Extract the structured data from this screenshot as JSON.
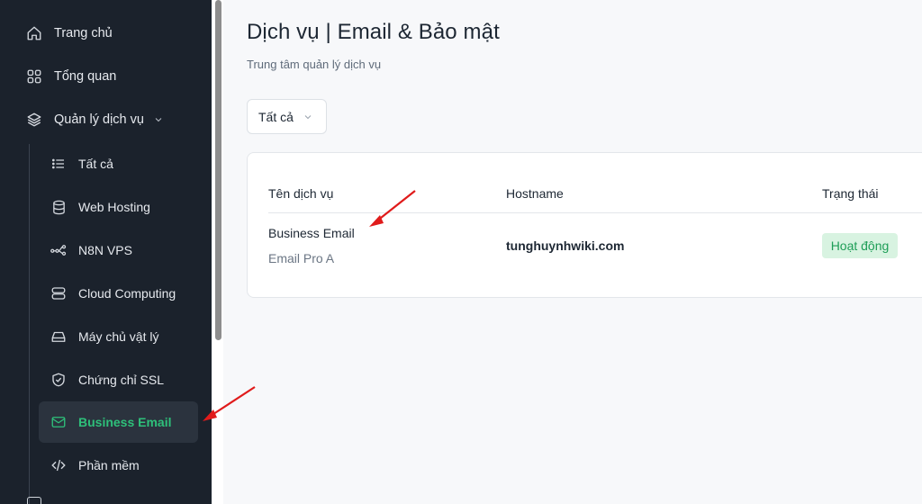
{
  "sidebar": {
    "items": [
      {
        "label": "Trang chủ",
        "icon": "home-icon"
      },
      {
        "label": "Tổng quan",
        "icon": "grid-icon"
      },
      {
        "label": "Quản lý dịch vụ",
        "icon": "layers-icon"
      }
    ],
    "sub_items": [
      {
        "label": "Tất cả",
        "icon": "list-icon"
      },
      {
        "label": "Web Hosting",
        "icon": "database-icon"
      },
      {
        "label": "N8N VPS",
        "icon": "nodes-icon"
      },
      {
        "label": "Cloud Computing",
        "icon": "server-icon"
      },
      {
        "label": "Máy chủ vật lý",
        "icon": "hard-drive-icon"
      },
      {
        "label": "Chứng chỉ SSL",
        "icon": "shield-check-icon"
      },
      {
        "label": "Business Email",
        "icon": "mail-icon"
      },
      {
        "label": "Phần mềm",
        "icon": "code-icon"
      }
    ]
  },
  "header": {
    "title": "Dịch vụ | Email & Bảo mật",
    "subtitle": "Trung tâm quản lý dịch vụ"
  },
  "filter": {
    "selected": "Tất cả"
  },
  "table": {
    "columns": [
      "Tên dịch vụ",
      "Hostname",
      "Trạng thái"
    ],
    "rows": [
      {
        "name": "Business Email",
        "plan": "Email Pro A",
        "hostname": "tunghuynhwiki.com",
        "status": "Hoạt động"
      }
    ]
  },
  "colors": {
    "sidebar_bg": "#1b222c",
    "accent_green": "#2ec07a",
    "status_bg": "#d8f3e1",
    "status_text": "#1e9e57",
    "annotation_arrow": "#e01b1b"
  }
}
